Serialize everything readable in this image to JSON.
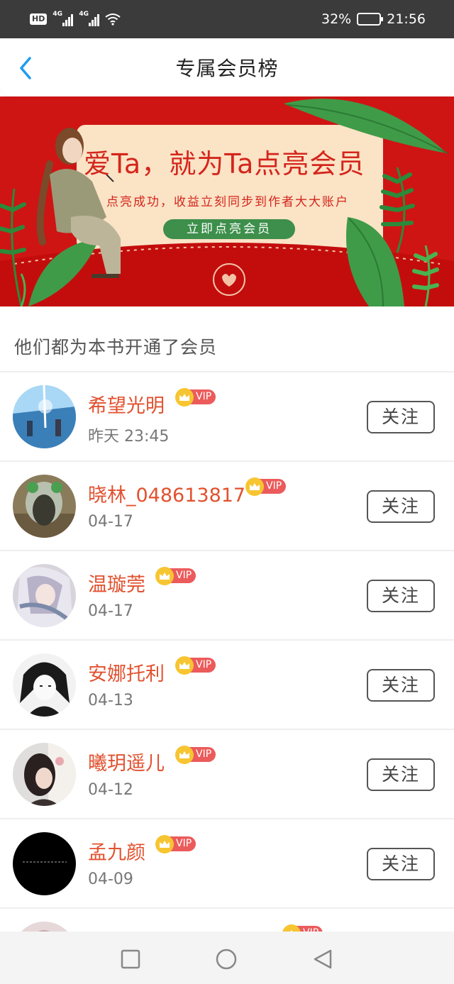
{
  "status_bar": {
    "hd_label": "HD",
    "network_1": "4G",
    "network_2": "4G",
    "battery_percent": "32%",
    "battery_level": 0.32,
    "time": "21:56"
  },
  "header": {
    "title": "专属会员榜",
    "back_icon": "chevron-left-icon"
  },
  "banner": {
    "heading": "爱Ta，就为Ta点亮会员",
    "subtitle": "点亮成功，收益立刻同步到作者大大账户",
    "button_label": "立即点亮会员",
    "colors": {
      "background": "#cf1414",
      "card": "#fbe3c6",
      "button": "#3d8f4b",
      "text": "#d4261c"
    }
  },
  "section": {
    "title": "他们都为本书开通了会员"
  },
  "vip_label": "VIP",
  "follow_label": "关注",
  "members": [
    {
      "name": "希望光明",
      "time": "昨天 23:45",
      "avatar": "anime-sky-scene"
    },
    {
      "name": "晓林_048613817",
      "time": "04-17",
      "avatar": "photo-playground"
    },
    {
      "name": "温璇莞",
      "time": "04-17",
      "avatar": "anime-white-hair-girl"
    },
    {
      "name": "安娜托利",
      "time": "04-13",
      "avatar": "manga-black-hair"
    },
    {
      "name": "曦玥遥儿",
      "time": "04-12",
      "avatar": "girl-portrait"
    },
    {
      "name": "孟九颜",
      "time": "04-09",
      "avatar": "black-quote-image"
    }
  ],
  "system_nav": {
    "recent": "square-icon",
    "home": "circle-icon",
    "back": "triangle-back-icon"
  }
}
